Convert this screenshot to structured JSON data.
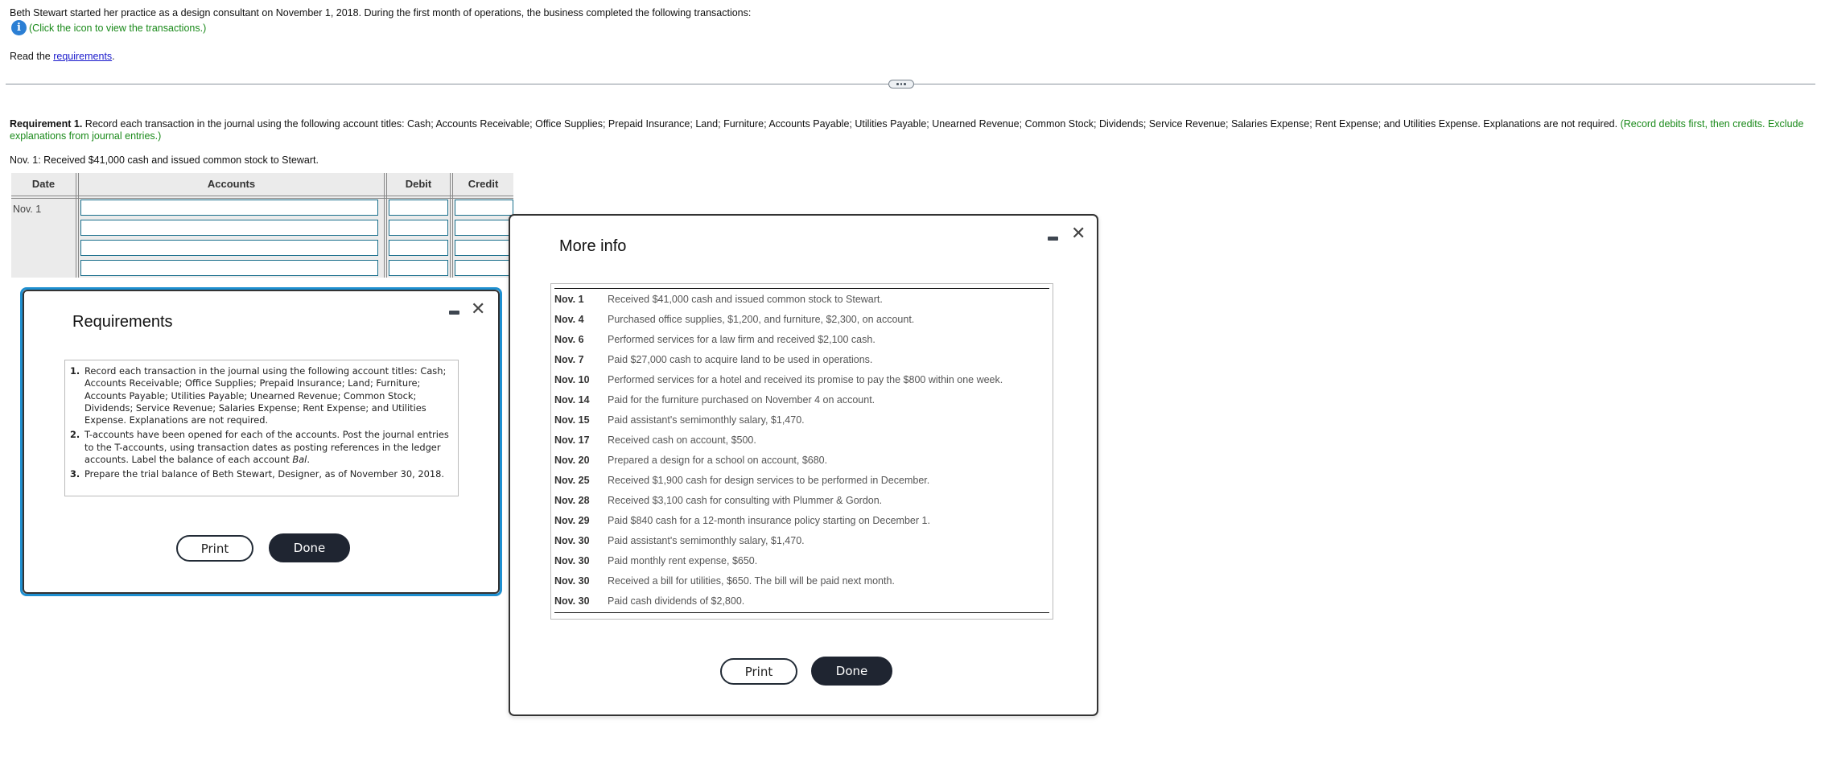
{
  "intro": {
    "text": "Beth Stewart started her practice as a design consultant on November 1, 2018. During the first month of operations, the business completed the following transactions:",
    "info_icon": "info-icon",
    "info_text": "(Click the icon to view the transactions.)",
    "read_prefix": "Read the ",
    "read_link": "requirements",
    "read_suffix": "."
  },
  "requirement1": {
    "label": "Requirement 1.",
    "text": " Record each transaction in the journal using the following account titles: Cash; Accounts Receivable; Office Supplies; Prepaid Insurance; Land; Furniture; Accounts Payable; Utilities Payable; Unearned Revenue; Common Stock; Dividends; Service Revenue; Salaries Expense; Rent Expense; and Utilities Expense. Explanations are not required. ",
    "hint": "(Record debits first, then credits. Exclude explanations from journal entries.)"
  },
  "transaction_prompt": "Nov. 1: Received $41,000 cash and issued common stock to Stewart.",
  "journal": {
    "headers": {
      "date": "Date",
      "accounts": "Accounts",
      "debit": "Debit",
      "credit": "Credit"
    },
    "date": "Nov. 1",
    "rows": [
      {
        "account": "",
        "debit": "",
        "credit": ""
      },
      {
        "account": "",
        "debit": "",
        "credit": ""
      },
      {
        "account": "",
        "debit": "",
        "credit": ""
      },
      {
        "account": "",
        "debit": "",
        "credit": ""
      }
    ]
  },
  "requirements_dialog": {
    "title": "Requirements",
    "items": [
      {
        "num": "1.",
        "text": "Record each transaction in the journal using the following account titles: Cash; Accounts Receivable; Office Supplies; Prepaid Insurance; Land; Furniture; Accounts Payable; Utilities Payable; Unearned Revenue; Common Stock; Dividends; Service Revenue; Salaries Expense; Rent Expense; and Utilities Expense. Explanations are not required."
      },
      {
        "num": "2.",
        "text": "T-accounts have been opened for each of the accounts. Post the journal entries to the T-accounts, using transaction dates as posting references in the ledger accounts. Label the balance of each account ",
        "italic": "Bal",
        "suffix": "."
      },
      {
        "num": "3.",
        "text": "Prepare the trial balance of Beth Stewart, Designer, as of November 30, 2018."
      }
    ],
    "print_label": "Print",
    "done_label": "Done"
  },
  "more_info_dialog": {
    "title": "More info",
    "transactions": [
      {
        "date": "Nov. 1",
        "desc": "Received $41,000 cash and issued common stock to Stewart."
      },
      {
        "date": "Nov. 4",
        "desc": "Purchased office supplies, $1,200, and furniture, $2,300, on account."
      },
      {
        "date": "Nov. 6",
        "desc": "Performed services for a law firm and received $2,100 cash."
      },
      {
        "date": "Nov. 7",
        "desc": "Paid $27,000 cash to acquire land to be used in operations."
      },
      {
        "date": "Nov. 10",
        "desc": "Performed services for a hotel and received its promise to pay the $800 within one week."
      },
      {
        "date": "Nov. 14",
        "desc": "Paid for the furniture purchased on November 4 on account."
      },
      {
        "date": "Nov. 15",
        "desc": "Paid assistant's semimonthly salary, $1,470."
      },
      {
        "date": "Nov. 17",
        "desc": "Received cash on account, $500."
      },
      {
        "date": "Nov. 20",
        "desc": "Prepared a design for a school on account, $680."
      },
      {
        "date": "Nov. 25",
        "desc": "Received $1,900 cash for design services to be performed in December."
      },
      {
        "date": "Nov. 28",
        "desc": "Received $3,100 cash for consulting with Plummer & Gordon."
      },
      {
        "date": "Nov. 29",
        "desc": "Paid $840 cash for a 12-month insurance policy starting on December 1."
      },
      {
        "date": "Nov. 30",
        "desc": "Paid assistant's semimonthly salary, $1,470."
      },
      {
        "date": "Nov. 30",
        "desc": "Paid monthly rent expense, $650."
      },
      {
        "date": "Nov. 30",
        "desc": "Received a bill for utilities, $650. The bill will be paid next month."
      },
      {
        "date": "Nov. 30",
        "desc": "Paid cash dividends of $2,800."
      }
    ],
    "print_label": "Print",
    "done_label": "Done"
  },
  "colors": {
    "accent_green": "#1a8a1a",
    "link_blue": "#1a1acc",
    "dialog_focus_border": "#1e8fd0",
    "button_dark": "#1f2531",
    "input_border": "#1a6f8c"
  }
}
